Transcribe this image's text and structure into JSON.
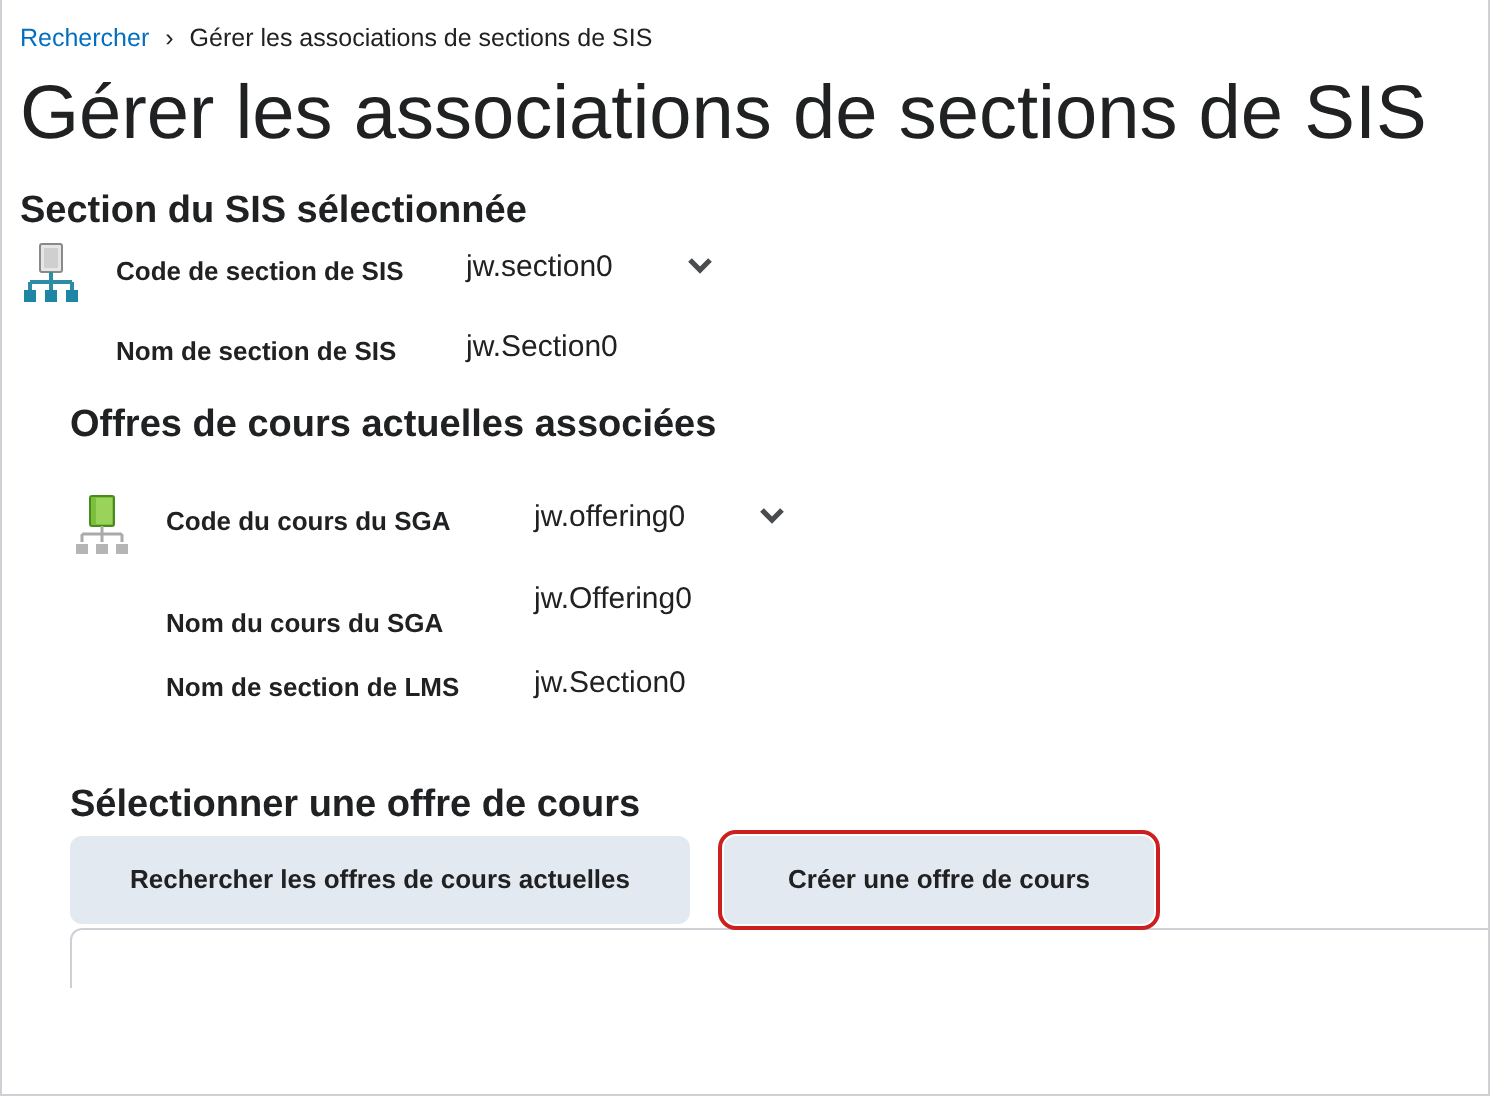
{
  "breadcrumb": {
    "link": "Rechercher",
    "separator": "›",
    "current": "Gérer les associations de sections de SIS"
  },
  "title": "Gérer les associations de sections de SIS",
  "sis_section": {
    "heading": "Section du SIS sélectionnée",
    "fields": [
      {
        "label": "Code de section de SIS",
        "value": "jw.section0",
        "expandable": true
      },
      {
        "label": "Nom de section de SIS",
        "value": "jw.Section0",
        "expandable": false
      }
    ]
  },
  "current_offerings": {
    "heading": "Offres de cours actuelles associées",
    "fields": [
      {
        "label": "Code du cours du SGA",
        "value": "jw.offering0",
        "expandable": true
      },
      {
        "label": "Nom du cours du SGA",
        "value": "jw.Offering0",
        "expandable": false
      },
      {
        "label": "Nom de section de LMS",
        "value": "jw.Section0",
        "expandable": false
      }
    ]
  },
  "select_offering": {
    "heading": "Sélectionner une offre de cours",
    "tabs": [
      {
        "label": "Rechercher les offres de cours actuelles",
        "highlighted": false
      },
      {
        "label": "Créer une offre de cours",
        "highlighted": true
      }
    ]
  }
}
